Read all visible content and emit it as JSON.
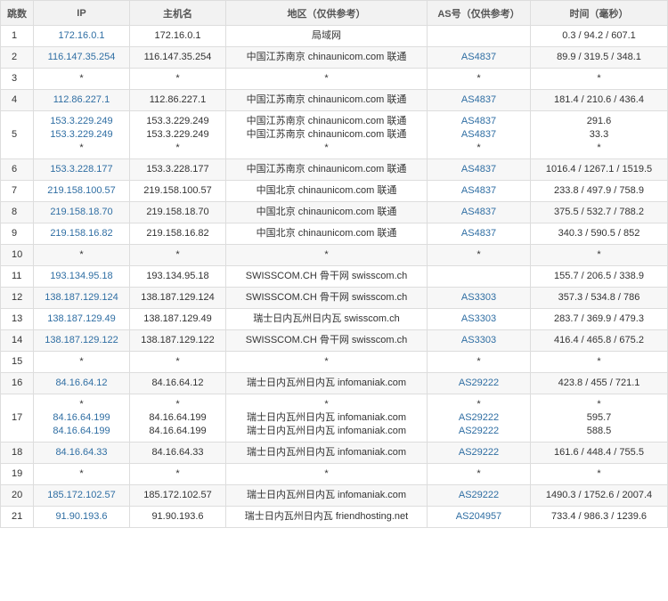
{
  "headers": {
    "hop": "跳数",
    "ip": "IP",
    "hostname": "主机名",
    "region": "地区（仅供参考）",
    "as": "AS号（仅供参考）",
    "time": "时间（毫秒）"
  },
  "rows": [
    {
      "hop": "1",
      "ips": [
        "172.16.0.1"
      ],
      "hosts": [
        "172.16.0.1"
      ],
      "regions": [
        "局域网"
      ],
      "as": [
        ""
      ],
      "times": [
        "0.3 / 94.2 / 607.1"
      ]
    },
    {
      "hop": "2",
      "ips": [
        "116.147.35.254"
      ],
      "hosts": [
        "116.147.35.254"
      ],
      "regions": [
        "中国江苏南京 chinaunicom.com 联通"
      ],
      "as": [
        "AS4837"
      ],
      "times": [
        "89.9 / 319.5 / 348.1"
      ]
    },
    {
      "hop": "3",
      "ips": [
        "*"
      ],
      "hosts": [
        "*"
      ],
      "regions": [
        "*"
      ],
      "as": [
        "*"
      ],
      "times": [
        "*"
      ]
    },
    {
      "hop": "4",
      "ips": [
        "112.86.227.1"
      ],
      "hosts": [
        "112.86.227.1"
      ],
      "regions": [
        "中国江苏南京 chinaunicom.com 联通"
      ],
      "as": [
        "AS4837"
      ],
      "times": [
        "181.4 / 210.6 / 436.4"
      ]
    },
    {
      "hop": "5",
      "ips": [
        "153.3.229.249",
        "153.3.229.249",
        "*"
      ],
      "hosts": [
        "153.3.229.249",
        "153.3.229.249",
        "*"
      ],
      "regions": [
        "中国江苏南京 chinaunicom.com 联通",
        "中国江苏南京 chinaunicom.com 联通",
        "*"
      ],
      "as": [
        "AS4837",
        "AS4837",
        "*"
      ],
      "times": [
        "291.6",
        "33.3",
        "*"
      ]
    },
    {
      "hop": "6",
      "ips": [
        "153.3.228.177"
      ],
      "hosts": [
        "153.3.228.177"
      ],
      "regions": [
        "中国江苏南京 chinaunicom.com 联通"
      ],
      "as": [
        "AS4837"
      ],
      "times": [
        "1016.4 / 1267.1 / 1519.5"
      ]
    },
    {
      "hop": "7",
      "ips": [
        "219.158.100.57"
      ],
      "hosts": [
        "219.158.100.57"
      ],
      "regions": [
        "中国北京 chinaunicom.com 联通"
      ],
      "as": [
        "AS4837"
      ],
      "times": [
        "233.8 / 497.9 / 758.9"
      ]
    },
    {
      "hop": "8",
      "ips": [
        "219.158.18.70"
      ],
      "hosts": [
        "219.158.18.70"
      ],
      "regions": [
        "中国北京 chinaunicom.com 联通"
      ],
      "as": [
        "AS4837"
      ],
      "times": [
        "375.5 / 532.7 / 788.2"
      ]
    },
    {
      "hop": "9",
      "ips": [
        "219.158.16.82"
      ],
      "hosts": [
        "219.158.16.82"
      ],
      "regions": [
        "中国北京 chinaunicom.com 联通"
      ],
      "as": [
        "AS4837"
      ],
      "times": [
        "340.3 / 590.5 / 852"
      ]
    },
    {
      "hop": "10",
      "ips": [
        "*"
      ],
      "hosts": [
        "*"
      ],
      "regions": [
        "*"
      ],
      "as": [
        "*"
      ],
      "times": [
        "*"
      ]
    },
    {
      "hop": "11",
      "ips": [
        "193.134.95.18"
      ],
      "hosts": [
        "193.134.95.18"
      ],
      "regions": [
        "SWISSCOM.CH 骨干网 swisscom.ch"
      ],
      "as": [
        ""
      ],
      "times": [
        "155.7 / 206.5 / 338.9"
      ]
    },
    {
      "hop": "12",
      "ips": [
        "138.187.129.124"
      ],
      "hosts": [
        "138.187.129.124"
      ],
      "regions": [
        "SWISSCOM.CH 骨干网 swisscom.ch"
      ],
      "as": [
        "AS3303"
      ],
      "times": [
        "357.3 / 534.8 / 786"
      ]
    },
    {
      "hop": "13",
      "ips": [
        "138.187.129.49"
      ],
      "hosts": [
        "138.187.129.49"
      ],
      "regions": [
        "瑞士日内瓦州日内瓦 swisscom.ch"
      ],
      "as": [
        "AS3303"
      ],
      "times": [
        "283.7 / 369.9 / 479.3"
      ]
    },
    {
      "hop": "14",
      "ips": [
        "138.187.129.122"
      ],
      "hosts": [
        "138.187.129.122"
      ],
      "regions": [
        "SWISSCOM.CH 骨干网 swisscom.ch"
      ],
      "as": [
        "AS3303"
      ],
      "times": [
        "416.4 / 465.8 / 675.2"
      ]
    },
    {
      "hop": "15",
      "ips": [
        "*"
      ],
      "hosts": [
        "*"
      ],
      "regions": [
        "*"
      ],
      "as": [
        "*"
      ],
      "times": [
        "*"
      ]
    },
    {
      "hop": "16",
      "ips": [
        "84.16.64.12"
      ],
      "hosts": [
        "84.16.64.12"
      ],
      "regions": [
        "瑞士日内瓦州日内瓦 infomaniak.com"
      ],
      "as": [
        "AS29222"
      ],
      "times": [
        "423.8 / 455 / 721.1"
      ]
    },
    {
      "hop": "17",
      "ips": [
        "*",
        "84.16.64.199",
        "84.16.64.199"
      ],
      "hosts": [
        "*",
        "84.16.64.199",
        "84.16.64.199"
      ],
      "regions": [
        "*",
        "瑞士日内瓦州日内瓦 infomaniak.com",
        "瑞士日内瓦州日内瓦 infomaniak.com"
      ],
      "as": [
        "*",
        "AS29222",
        "AS29222"
      ],
      "times": [
        "*",
        "595.7",
        "588.5"
      ]
    },
    {
      "hop": "18",
      "ips": [
        "84.16.64.33"
      ],
      "hosts": [
        "84.16.64.33"
      ],
      "regions": [
        "瑞士日内瓦州日内瓦 infomaniak.com"
      ],
      "as": [
        "AS29222"
      ],
      "times": [
        "161.6 / 448.4 / 755.5"
      ]
    },
    {
      "hop": "19",
      "ips": [
        "*"
      ],
      "hosts": [
        "*"
      ],
      "regions": [
        "*"
      ],
      "as": [
        "*"
      ],
      "times": [
        "*"
      ]
    },
    {
      "hop": "20",
      "ips": [
        "185.172.102.57"
      ],
      "hosts": [
        "185.172.102.57"
      ],
      "regions": [
        "瑞士日内瓦州日内瓦 infomaniak.com"
      ],
      "as": [
        "AS29222"
      ],
      "times": [
        "1490.3 / 1752.6 / 2007.4"
      ]
    },
    {
      "hop": "21",
      "ips": [
        "91.90.193.6"
      ],
      "hosts": [
        "91.90.193.6"
      ],
      "regions": [
        "瑞士日内瓦州日内瓦 friendhosting.net"
      ],
      "as": [
        "AS204957"
      ],
      "times": [
        "733.4 / 986.3 / 1239.6"
      ]
    }
  ],
  "colors": {
    "link": "#2f6ea3",
    "stripe": "#f7f7f7",
    "border": "#dddddd",
    "header_bg": "#f2f2f2"
  }
}
